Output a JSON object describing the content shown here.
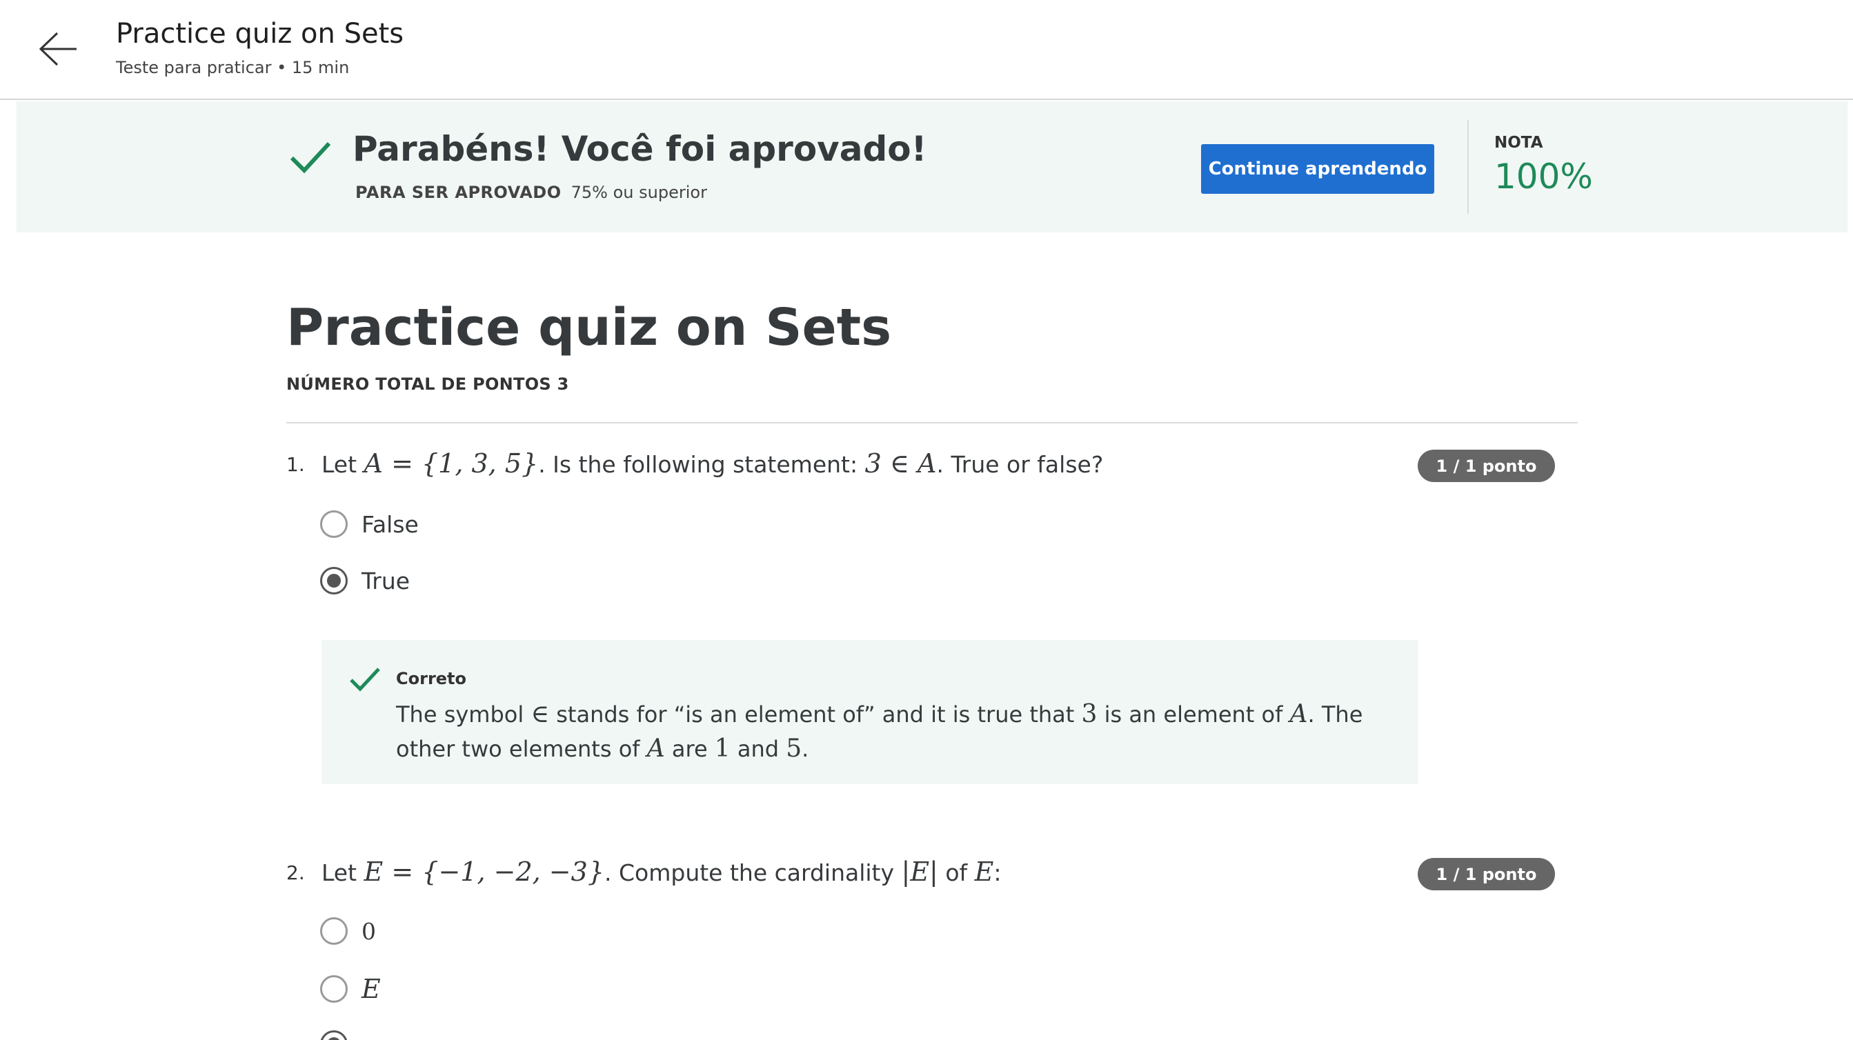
{
  "header": {
    "title": "Practice quiz on Sets",
    "subtitle": "Teste para praticar • 15 min"
  },
  "banner": {
    "title": "Parabéns! Você foi aprovado!",
    "requirement_label": "PARA SER APROVADO",
    "requirement_value": "75% ou superior",
    "continue_label": "Continue aprendendo",
    "grade_label": "NOTA",
    "grade_value": "100%"
  },
  "quiz": {
    "title": "Practice quiz on Sets",
    "total_points": "NÚMERO TOTAL DE PONTOS 3",
    "questions": [
      {
        "number": "1.",
        "text_parts": [
          "Let ",
          "A = {1, 3, 5}",
          ". Is the following statement: ",
          "3 ∈ A",
          ". True or false?"
        ],
        "badge": "1 / 1 ponto",
        "options": [
          {
            "label": "False",
            "selected": false
          },
          {
            "label": "True",
            "selected": true
          }
        ],
        "feedback": {
          "title": "Correto",
          "text_parts": [
            "The symbol ",
            "∈",
            " stands for “is an element of” and it is true that ",
            "3",
            " is an element of ",
            "A",
            ". The other two elements of ",
            "A",
            " are ",
            "1",
            " and ",
            "5",
            "."
          ]
        }
      },
      {
        "number": "2.",
        "text_parts": [
          "Let ",
          "E = {−1, −2, −3}",
          ". Compute the cardinality ",
          "|E|",
          " of ",
          "E",
          ":"
        ],
        "badge": "1 / 1 ponto",
        "options": [
          {
            "label": "0",
            "selected": false
          },
          {
            "label": "E",
            "selected": false
          }
        ]
      }
    ]
  },
  "colors": {
    "accent_blue": "#1f6fd0",
    "success_green": "#1e8a59",
    "banner_bg": "#f1f7f5",
    "badge_bg": "#666666"
  },
  "icons": {
    "back": "arrow-left-icon",
    "pass": "checkmark-icon",
    "correct": "checkmark-icon"
  }
}
